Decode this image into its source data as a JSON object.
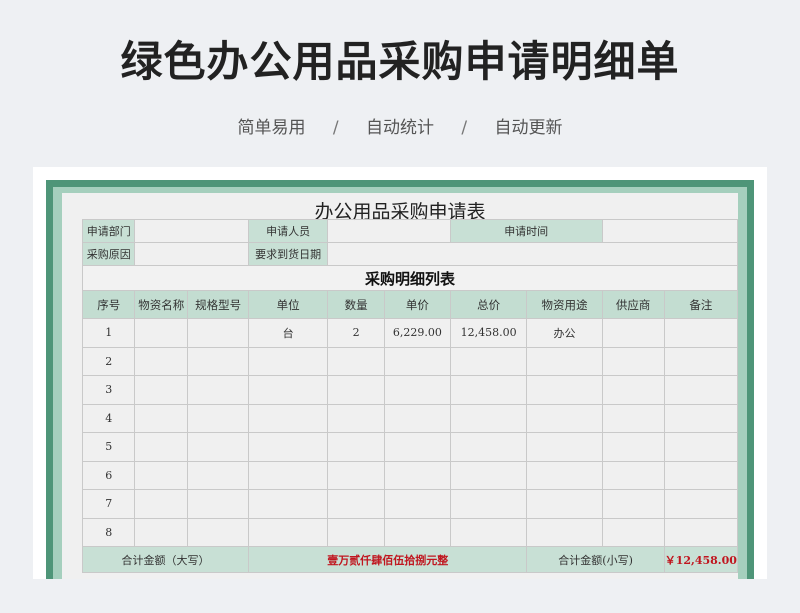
{
  "page": {
    "title": "绿色办公用品采购申请明细单",
    "tags": [
      "简单易用",
      "自动统计",
      "自动更新"
    ],
    "separator": "/"
  },
  "sheet": {
    "title": "办公用品采购申请表",
    "fields": {
      "dept_label": "申请部门",
      "dept_value": "",
      "applicant_label": "申请人员",
      "applicant_value": "",
      "time_label": "申请时间",
      "time_value": "",
      "reason_label": "采购原因",
      "reason_value": "",
      "arrival_label": "要求到货日期",
      "arrival_value": ""
    },
    "detail_title": "采购明细列表",
    "columns": [
      "序号",
      "物资名称",
      "规格型号",
      "单位",
      "数量",
      "单价",
      "总价",
      "物资用途",
      "供应商",
      "备注"
    ],
    "rows": [
      [
        "1",
        "",
        "",
        "台",
        "2",
        "6,229.00",
        "12,458.00",
        "办公",
        "",
        ""
      ],
      [
        "2",
        "",
        "",
        "",
        "",
        "",
        "",
        "",
        "",
        ""
      ],
      [
        "3",
        "",
        "",
        "",
        "",
        "",
        "",
        "",
        "",
        ""
      ],
      [
        "4",
        "",
        "",
        "",
        "",
        "",
        "",
        "",
        "",
        ""
      ],
      [
        "5",
        "",
        "",
        "",
        "",
        "",
        "",
        "",
        "",
        ""
      ],
      [
        "6",
        "",
        "",
        "",
        "",
        "",
        "",
        "",
        "",
        ""
      ],
      [
        "7",
        "",
        "",
        "",
        "",
        "",
        "",
        "",
        "",
        ""
      ],
      [
        "8",
        "",
        "",
        "",
        "",
        "",
        "",
        "",
        "",
        ""
      ]
    ],
    "totals": {
      "upper_label": "合计金额（大写）",
      "upper_value": "壹万贰仟肆佰伍拾捌元整",
      "lower_label": "合计金额(小写)",
      "lower_value": "￥12,458.00"
    }
  },
  "colors": {
    "frame_dark": "#4e9578",
    "frame_light": "#a5cfbd",
    "header_fill": "#c3ddd1",
    "total_text": "#c0161f"
  }
}
